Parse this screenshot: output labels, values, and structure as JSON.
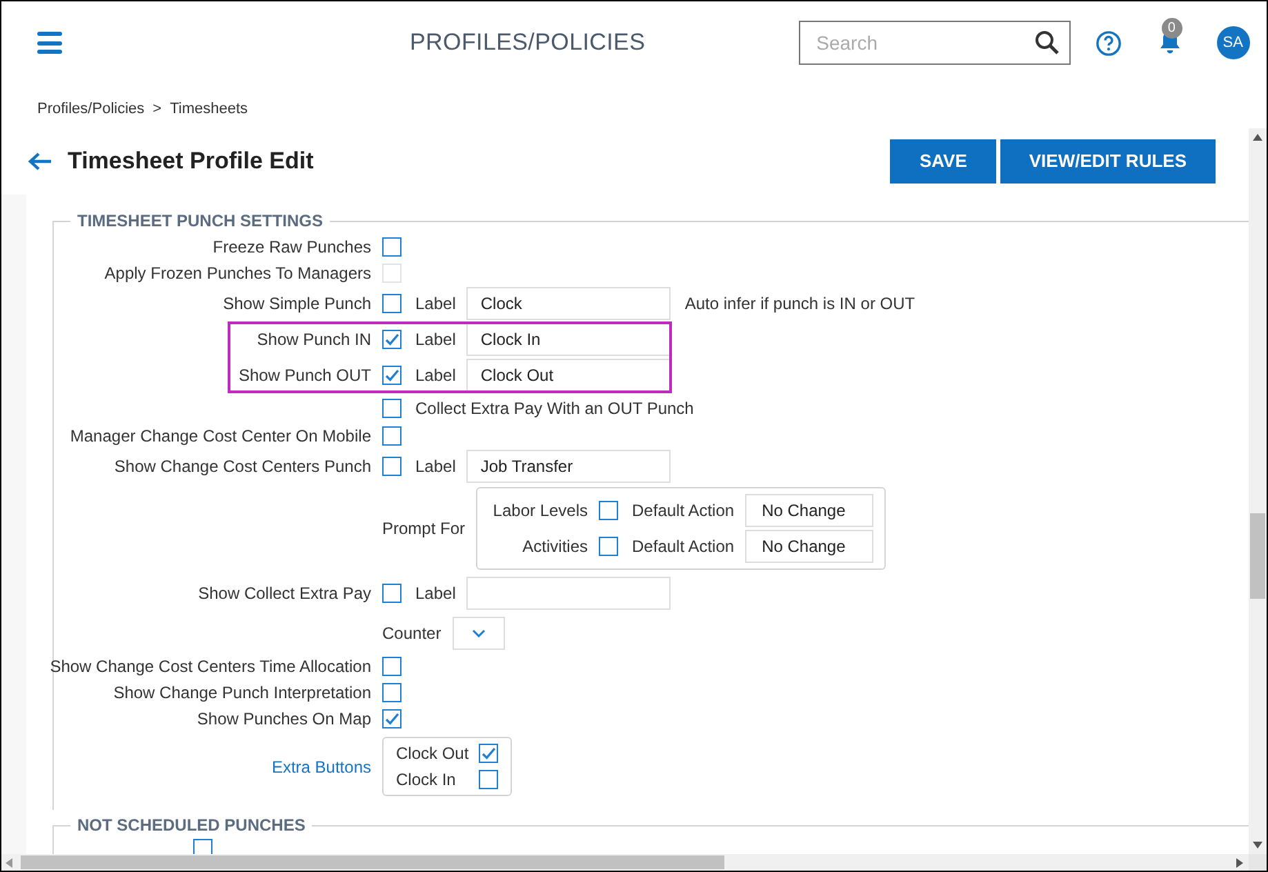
{
  "header": {
    "title": "PROFILES/POLICIES",
    "search": {
      "placeholder": "Search"
    },
    "notifications": {
      "count": "0"
    },
    "avatar": "SA"
  },
  "breadcrumb": [
    "Profiles/Policies",
    ">",
    "Timesheets"
  ],
  "page": {
    "title": "Timesheet Profile Edit",
    "buttons": [
      "SAVE",
      "VIEW/EDIT RULES"
    ]
  },
  "sections": [
    {
      "title": "TIMESHEET PUNCH SETTINGS",
      "rows": [
        {
          "kind": "check",
          "label": "Freeze Raw Punches",
          "checked": false,
          "disabled": false,
          "highlighted": false
        },
        {
          "kind": "check",
          "label": "Apply Frozen Punches To Managers",
          "checked": false,
          "disabled": true,
          "highlighted": false
        },
        {
          "kind": "check_field",
          "label": "Show Simple Punch",
          "checked": false,
          "field_label": "Label",
          "value": "Clock",
          "note": "Auto infer if punch is IN or OUT",
          "highlighted": false
        },
        {
          "kind": "check_field",
          "label": "Show Punch IN",
          "checked": true,
          "field_label": "Label",
          "value": "Clock In",
          "highlighted": true
        },
        {
          "kind": "check_field",
          "label": "Show Punch OUT",
          "checked": true,
          "field_label": "Label",
          "value": "Clock Out",
          "highlighted": true
        },
        {
          "kind": "check_after",
          "text": "Collect Extra Pay With an OUT Punch",
          "checked": false,
          "highlighted": false
        },
        {
          "kind": "check",
          "label": "Manager Change Cost Center On Mobile",
          "checked": false,
          "disabled": false,
          "highlighted": false
        },
        {
          "kind": "check_field",
          "label": "Show Change Cost Centers Punch",
          "checked": false,
          "field_label": "Label",
          "value": "Job Transfer",
          "highlighted": false
        },
        {
          "kind": "prompt",
          "label": "Prompt For",
          "highlighted": false,
          "items": [
            {
              "label": "Labor Levels",
              "checked": false,
              "action_label": "Default Action",
              "value": "No Change"
            },
            {
              "label": "Activities",
              "checked": false,
              "action_label": "Default Action",
              "value": "No Change"
            }
          ]
        },
        {
          "kind": "check_field",
          "label": "Show Collect Extra Pay",
          "checked": false,
          "field_label": "Label",
          "highlighted": false
        },
        {
          "kind": "select_after",
          "text": "Counter",
          "highlighted": false
        },
        {
          "kind": "check",
          "label": "Show Change Cost Centers Time Allocation",
          "checked": false,
          "disabled": false,
          "highlighted": false
        },
        {
          "kind": "check",
          "label": "Show Change Punch Interpretation",
          "checked": false,
          "disabled": false,
          "highlighted": false
        },
        {
          "kind": "check",
          "label": "Show Punches On Map",
          "checked": true,
          "disabled": false,
          "highlighted": false
        },
        {
          "kind": "check_group",
          "label": "Extra Buttons",
          "highlighted": false,
          "items": [
            {
              "label": "Clock Out",
              "checked": true
            },
            {
              "label": "Clock In",
              "checked": false
            }
          ]
        }
      ]
    },
    {
      "title": "NOT SCHEDULED PUNCHES",
      "rows": [
        {
          "kind": "check_offset",
          "checked": false,
          "highlighted": false
        }
      ]
    }
  ]
}
